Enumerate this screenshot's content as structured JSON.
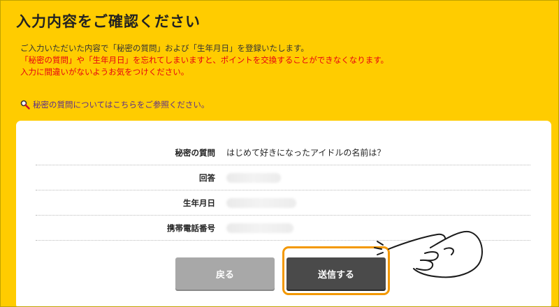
{
  "page": {
    "title": "入力内容をご確認ください"
  },
  "intro": {
    "line1": "ご入力いただいた内容で「秘密の質問」および「生年月日」を登録いたします。",
    "warning1": "「秘密の質問」や「生年月日」を忘れてしまいますと、ポイントを交換することができなくなります。",
    "warning2": "入力に間違いがないようお気をつけください。"
  },
  "help_link": {
    "icon": "magnifier-icon",
    "label": "秘密の質問についてはこちらをご参照ください。"
  },
  "form": {
    "rows": [
      {
        "label": "秘密の質問",
        "value": "はじめて好きになったアイドルの名前は？"
      },
      {
        "label": "回答",
        "value": ""
      },
      {
        "label": "生年月日",
        "value": ""
      },
      {
        "label": "携帯電話番号",
        "value": ""
      }
    ]
  },
  "buttons": {
    "back_label": "戻る",
    "send_label": "送信する"
  },
  "colors": {
    "background": "#ffcc00",
    "warning_text": "#e60012",
    "link_text": "#5a2d8c",
    "back_button": "#a8a8a8",
    "send_button": "#4a4a4a",
    "highlight_outline": "#f39800"
  },
  "annotation": {
    "pointer_icon": "pointing-hand-icon"
  }
}
